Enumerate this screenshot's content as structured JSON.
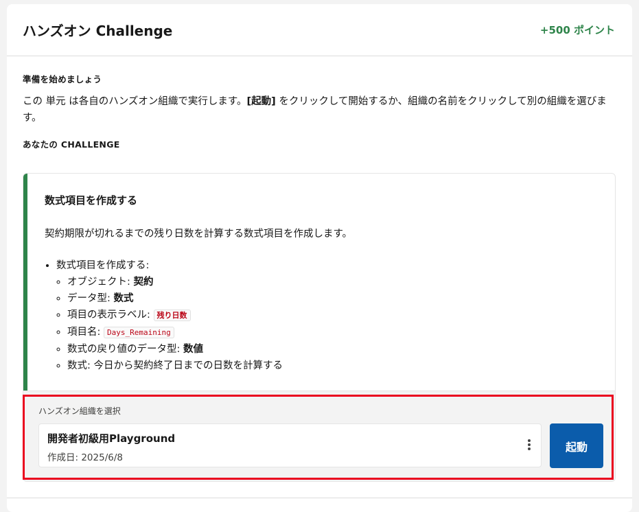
{
  "header": {
    "title": "ハンズオン Challenge",
    "points": "+500 ポイント"
  },
  "intro": {
    "label": "準備を始めましょう",
    "text_part1": "この 単元 は各自のハンズオン組織で実行します。",
    "text_bold": "[起動]",
    "text_part2": " をクリックして開始するか、組織の名前をクリックして別の組織を選びます。"
  },
  "challenge_label": "あなたの CHALLENGE",
  "challenge": {
    "title": "数式項目を作成する",
    "description": "契約期限が切れるまでの残り日数を計算する数式項目を作成します。",
    "task_main": "数式項目を作成する:",
    "sub_items": {
      "object_label": "オブジェクト: ",
      "object_value": "契約",
      "datatype_label": "データ型: ",
      "datatype_value": "数式",
      "field_label_label": "項目の表示ラベル: ",
      "field_label_value": "残り日数",
      "field_name_label": "項目名: ",
      "field_name_value": "Days_Remaining",
      "return_type_label": "数式の戻り値のデータ型: ",
      "return_type_value": "数値",
      "formula": "数式: 今日から契約終了日までの日数を計算する"
    }
  },
  "org_select": {
    "label": "ハンズオン組織を選択",
    "org_name": "開発者初級用Playground",
    "created_date": "作成日: 2025/6/8",
    "launch_label": "起動"
  },
  "colors": {
    "accent_green": "#2e844a",
    "brand_blue": "#0b5cab",
    "highlight_red": "#ea001e",
    "code_red": "#ba0517"
  },
  "icons": {
    "menu": "kebab-menu-icon"
  }
}
